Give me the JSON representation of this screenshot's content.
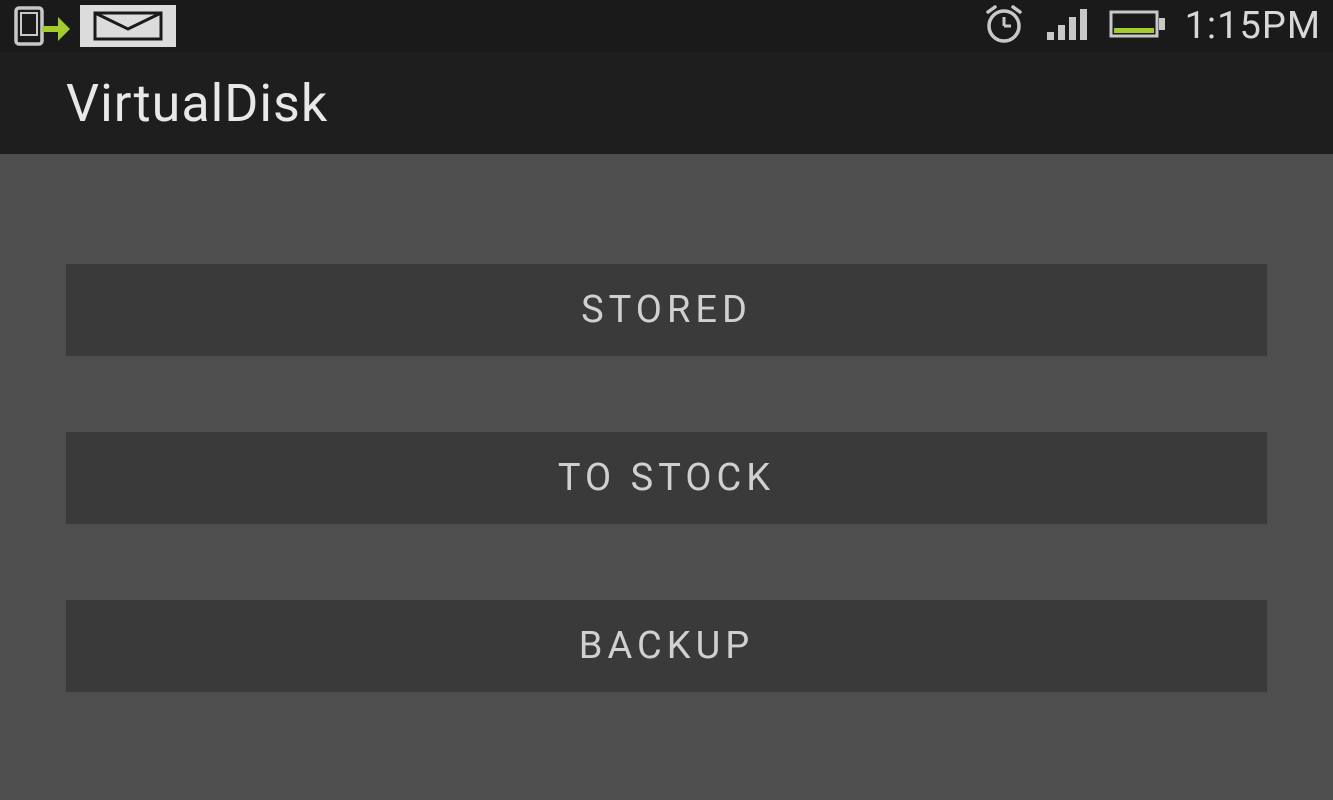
{
  "status_bar": {
    "time": "1:15PM",
    "icons": {
      "phone_sync": "phone-sync-icon",
      "mail": "mail-icon",
      "alarm": "alarm-icon",
      "signal": "signal-icon",
      "battery": "battery-icon"
    }
  },
  "app_bar": {
    "title": "VirtualDisk"
  },
  "main": {
    "buttons": [
      {
        "label": "STORED"
      },
      {
        "label": "TO STOCK"
      },
      {
        "label": "BACKUP"
      }
    ]
  }
}
